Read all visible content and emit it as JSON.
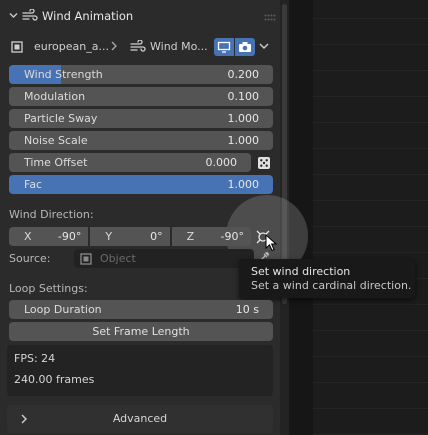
{
  "header": {
    "title": "Wind Animation",
    "icon": "wind-icon"
  },
  "breadcrumb": {
    "object_name": "european_a...",
    "modifier_name": "Wind Mo..."
  },
  "properties": [
    {
      "label": "Wind Strength",
      "value": "0.200",
      "fill_fraction": 0.2
    },
    {
      "label": "Modulation",
      "value": "0.100"
    },
    {
      "label": "Particle Sway",
      "value": "1.000"
    },
    {
      "label": "Noise Scale",
      "value": "1.000"
    },
    {
      "label": "Time Offset",
      "value": "0.000"
    },
    {
      "label": "Fac",
      "value": "1.000",
      "fill_fraction": 1.0
    }
  ],
  "wind_direction": {
    "label": "Wind Direction:",
    "x_label": "X",
    "x_value": "-90°",
    "y_label": "Y",
    "y_value": "0°",
    "z_label": "Z",
    "z_value": "-90°"
  },
  "source": {
    "label": "Source:",
    "placeholder": "Object"
  },
  "tooltip": {
    "title": "Set wind direction",
    "description": "Set a wind cardinal direction."
  },
  "loop": {
    "label": "Loop Settings:",
    "duration_label": "Loop Duration",
    "duration_value": "10 s",
    "set_frame_button": "Set Frame Length",
    "fps_text": "FPS: 24",
    "frames_text": "240.00 frames"
  },
  "advanced": {
    "label": "Advanced"
  },
  "colors": {
    "accent": "#4772b3",
    "field": "#545454",
    "panel": "#2b2b2b",
    "tooltip_bg": "#191919"
  }
}
